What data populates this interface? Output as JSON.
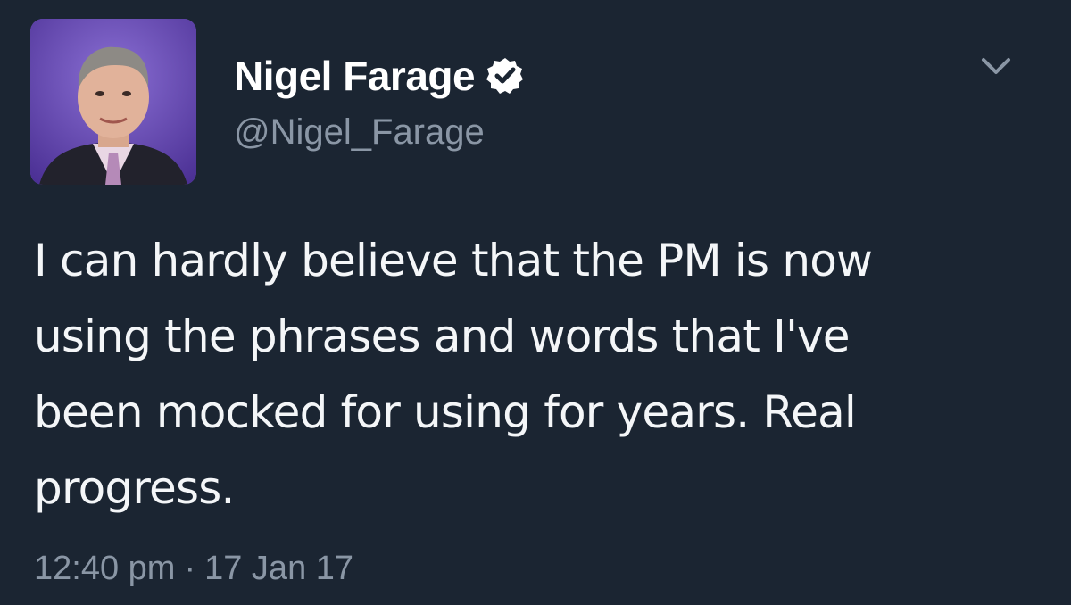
{
  "tweet": {
    "author": {
      "display_name": "Nigel Farage",
      "handle": "@Nigel_Farage",
      "verified": true,
      "avatar_icon": "profile-photo"
    },
    "text": "I can hardly believe that the PM is now\nusing the phrases and words that I've\nbeen mocked for using for years. Real\nprogress.",
    "time": "12:40 pm",
    "separator": "·",
    "date": "17 Jan 17",
    "menu_icon": "chevron-down-icon"
  },
  "colors": {
    "background": "#1b2532",
    "text_primary": "#ffffff",
    "text_secondary": "#8a96a5"
  }
}
